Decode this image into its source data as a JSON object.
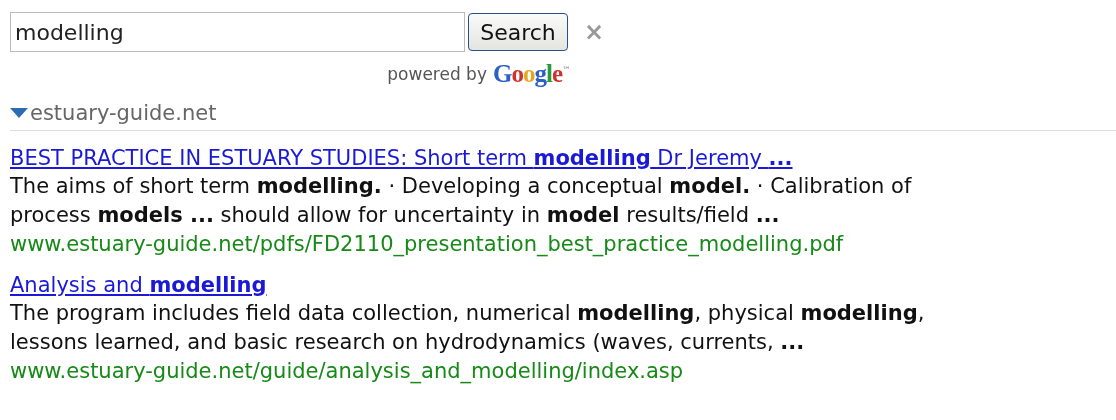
{
  "search": {
    "value": "modelling",
    "button": "Search",
    "clear": "×",
    "powered_by": "powered by",
    "brand": "Google",
    "brand_mark": "™"
  },
  "section": {
    "label": "estuary-guide.net",
    "expanded": true
  },
  "results": [
    {
      "title": "BEST PRACTICE IN ESTUARY STUDIES: Short term **modelling** Dr Jeremy **...**",
      "snippet": "The aims of short term **modelling.** · Developing a conceptual **model.** · Calibration of\nprocess **models ...** should allow for uncertainty in **model** results/field **...**",
      "url": "www.estuary-guide.net/pdfs/FD2110_presentation_best_practice_modelling.pdf"
    },
    {
      "title": "Analysis and **modelling**",
      "snippet": "The program includes field data collection, numerical **modelling**, physical **modelling**,\nlessons learned, and basic research on hydrodynamics (waves, currents, **...**",
      "url": "www.estuary-guide.net/guide/analysis_and_modelling/index.asp"
    }
  ]
}
